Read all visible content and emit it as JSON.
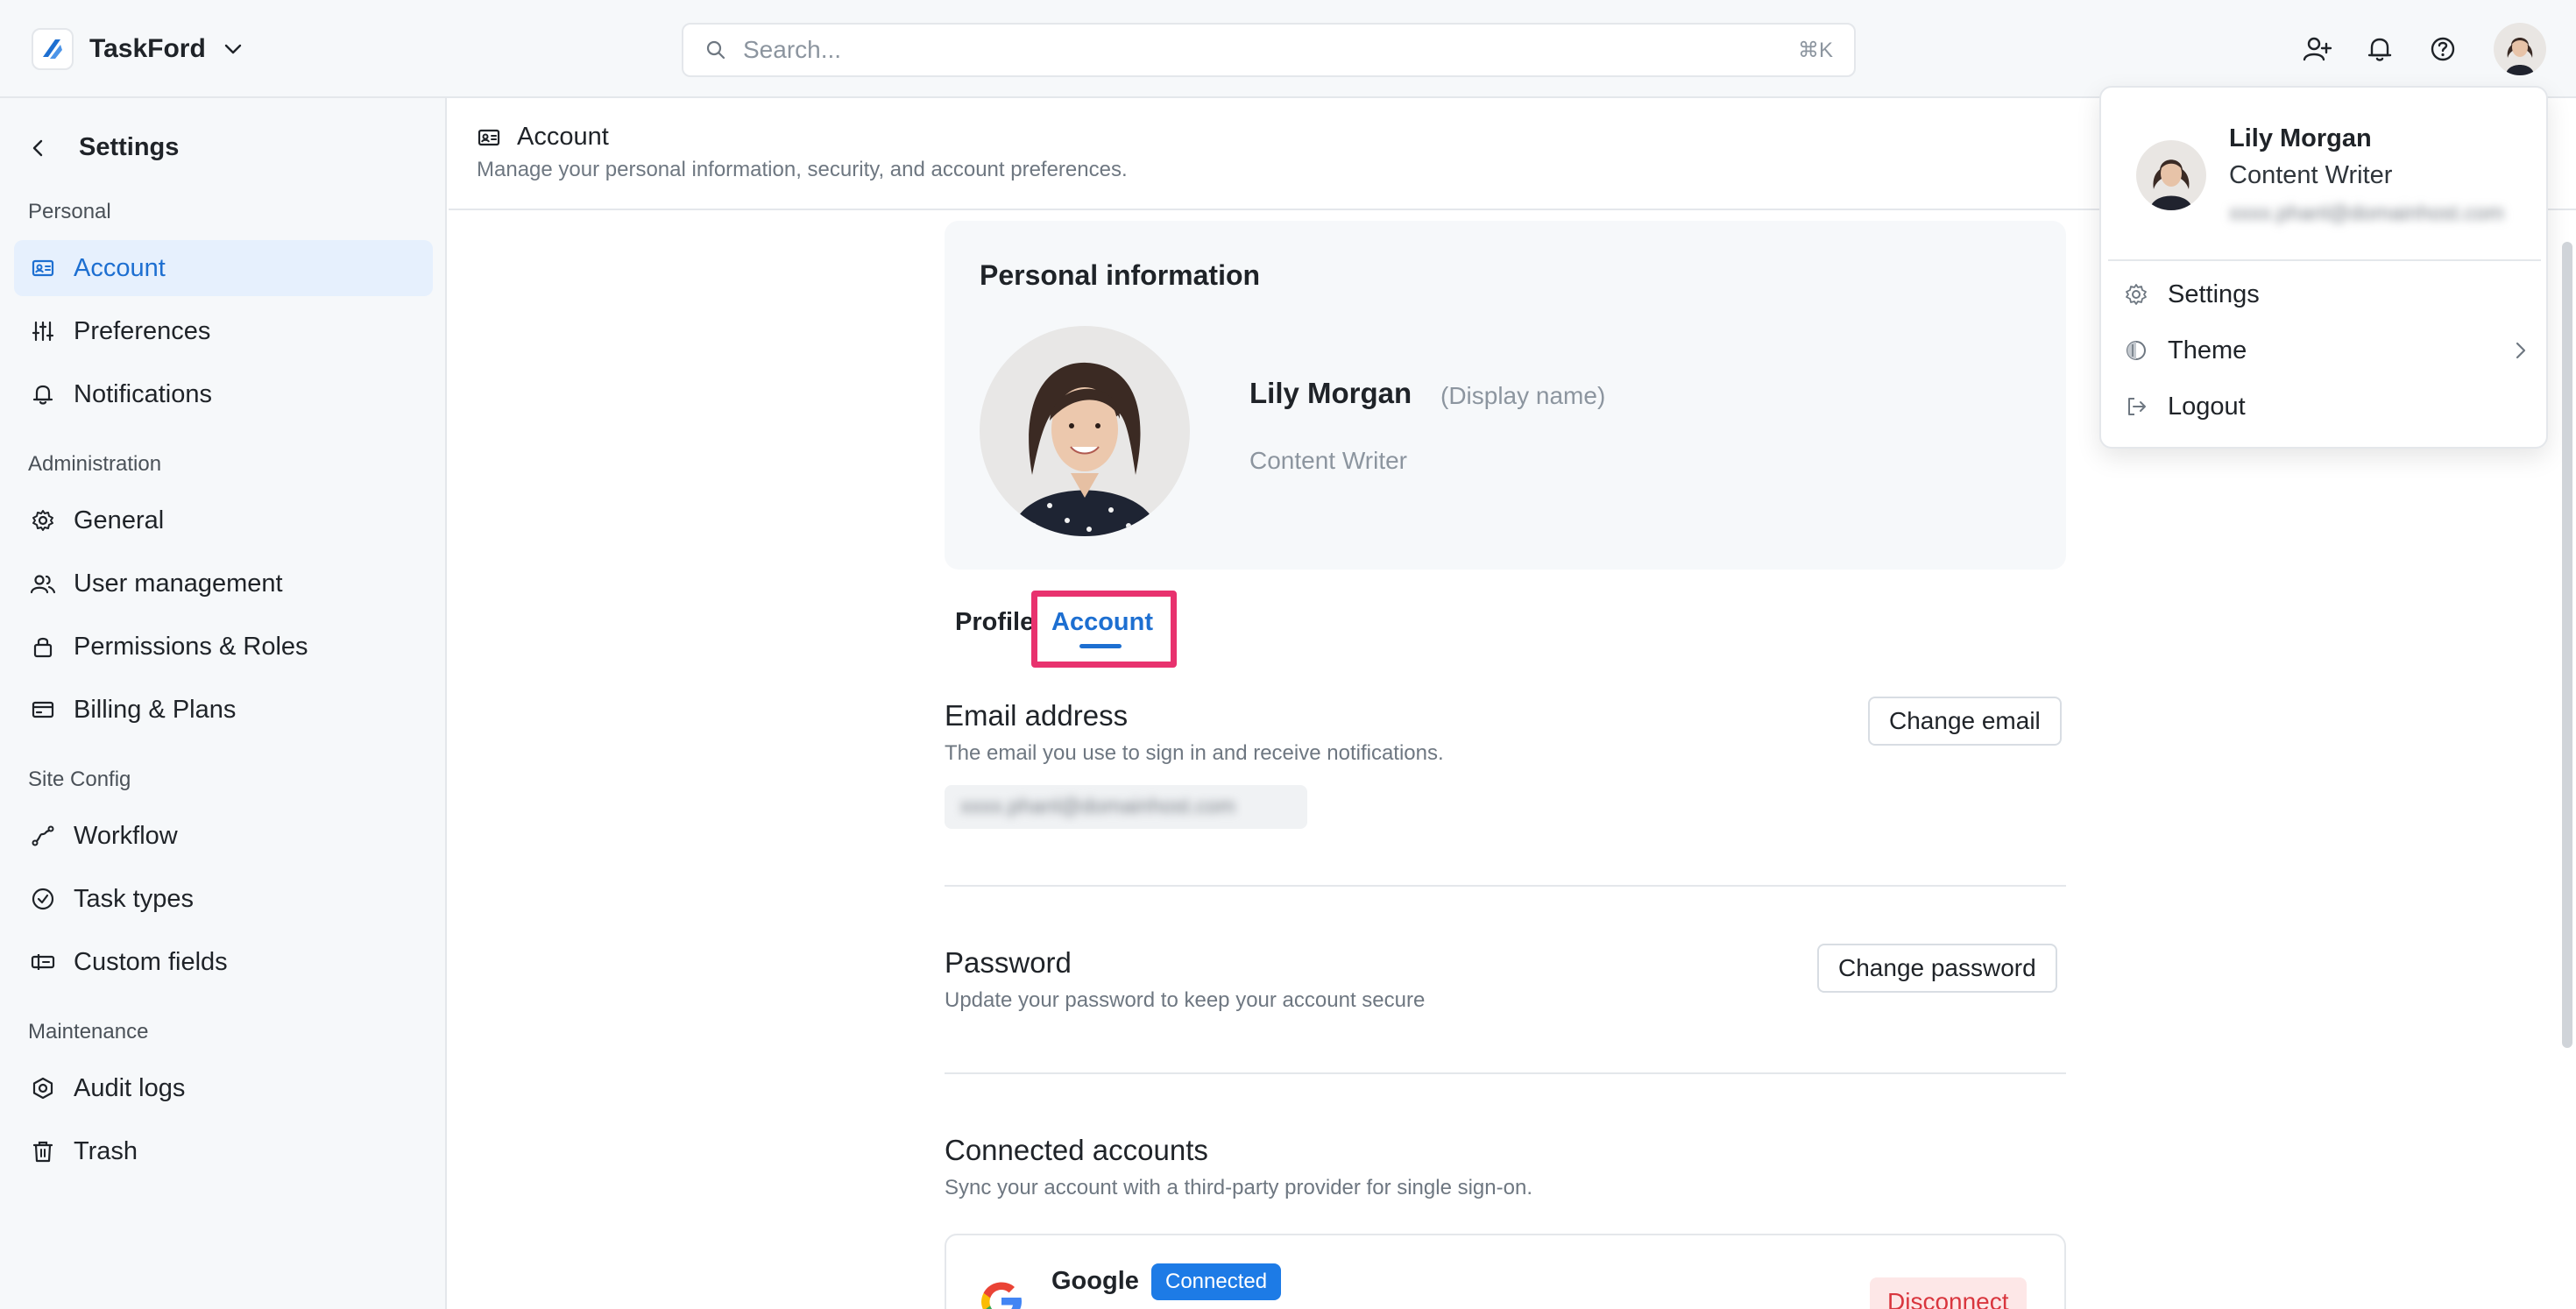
{
  "app": {
    "name": "TaskFord"
  },
  "search": {
    "placeholder": "Search...",
    "shortcut": "⌘K"
  },
  "sidebar": {
    "title": "Settings",
    "sections": [
      {
        "label": "Personal",
        "items": [
          "Account",
          "Preferences",
          "Notifications"
        ]
      },
      {
        "label": "Administration",
        "items": [
          "General",
          "User management",
          "Permissions & Roles",
          "Billing & Plans"
        ]
      },
      {
        "label": "Site Config",
        "items": [
          "Workflow",
          "Task types",
          "Custom fields"
        ]
      },
      {
        "label": "Maintenance",
        "items": [
          "Audit logs",
          "Trash"
        ]
      }
    ],
    "active_item": "Account"
  },
  "header": {
    "title": "Account",
    "subtitle": "Manage your personal information, security, and account preferences."
  },
  "personal_info": {
    "title": "Personal information",
    "name": "Lily Morgan",
    "display_name_hint": "(Display name)",
    "role": "Content Writer"
  },
  "tabs": {
    "profile": "Profile",
    "account": "Account",
    "active": "Account"
  },
  "email_section": {
    "title": "Email address",
    "description": "The email you use to sign in and receive notifications.",
    "value": "xxxx.phanl@domainhost.com",
    "button": "Change email"
  },
  "password_section": {
    "title": "Password",
    "description": "Update your password to keep your account secure",
    "button": "Change password"
  },
  "connected_section": {
    "title": "Connected accounts",
    "description": "Sync your account with a third-party provider for single sign-on.",
    "provider": "Google",
    "status": "Connected",
    "action": "Disconnect"
  },
  "user_menu": {
    "name": "Lily Morgan",
    "role": "Content Writer",
    "email": "xxxx.phanl@domainhost.com",
    "items": [
      "Settings",
      "Theme",
      "Logout"
    ]
  },
  "colors": {
    "accent": "#1d6fd1",
    "highlight_box": "#e8326e",
    "badge": "#1d7be6",
    "danger": "#d9363e"
  }
}
